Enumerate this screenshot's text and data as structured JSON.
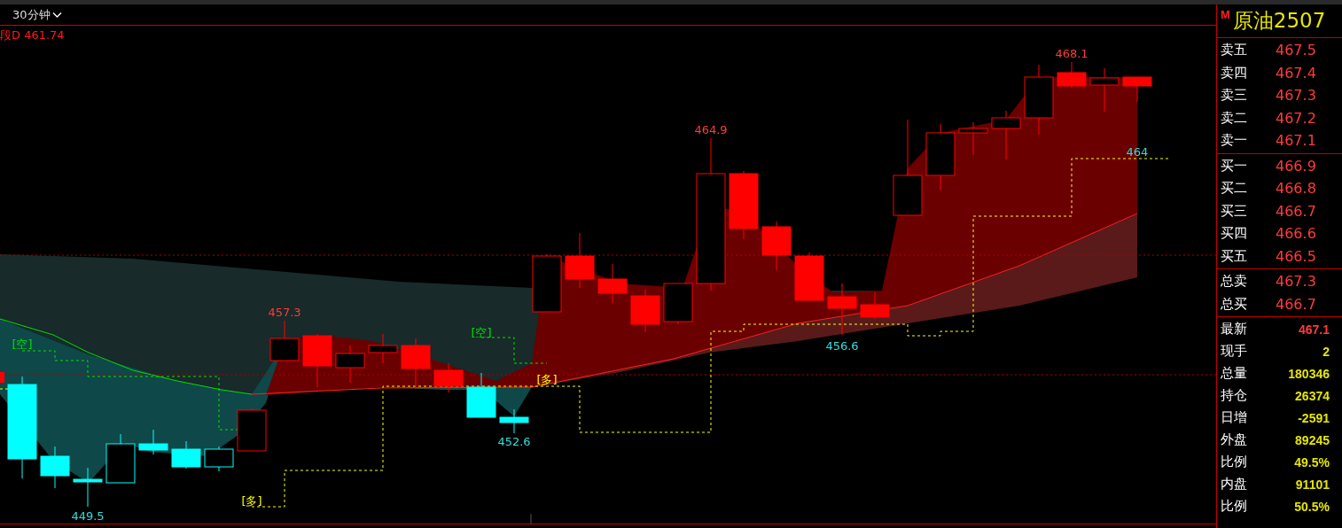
{
  "toolbar": {
    "period": "30分钟"
  },
  "indicator": {
    "label": "段D 461.74"
  },
  "chart": {
    "labels": [
      {
        "text": "449.5",
        "kind": "low"
      },
      {
        "text": "[空]",
        "kind": "short"
      },
      {
        "text": "[多]",
        "kind": "long"
      },
      {
        "text": "457.3",
        "kind": "high"
      },
      {
        "text": "[空]",
        "kind": "short"
      },
      {
        "text": "452.6",
        "kind": "low"
      },
      {
        "text": "[多]",
        "kind": "long"
      },
      {
        "text": "464.9",
        "kind": "high"
      },
      {
        "text": "456.6",
        "kind": "low"
      },
      {
        "text": "468.1",
        "kind": "high"
      },
      {
        "text": "464",
        "kind": "low"
      }
    ]
  },
  "quote": {
    "badge": "M",
    "name": "原油2507",
    "groups": [
      [
        {
          "label": "卖五",
          "value": "467.5",
          "kind": "price"
        },
        {
          "label": "卖四",
          "value": "467.4",
          "kind": "price"
        },
        {
          "label": "卖三",
          "value": "467.3",
          "kind": "price"
        },
        {
          "label": "卖二",
          "value": "467.2",
          "kind": "price"
        },
        {
          "label": "卖一",
          "value": "467.1",
          "kind": "price"
        }
      ],
      [
        {
          "label": "买一",
          "value": "466.9",
          "kind": "price"
        },
        {
          "label": "买二",
          "value": "466.8",
          "kind": "price"
        },
        {
          "label": "买三",
          "value": "466.7",
          "kind": "price"
        },
        {
          "label": "买四",
          "value": "466.6",
          "kind": "price"
        },
        {
          "label": "买五",
          "value": "466.5",
          "kind": "price"
        }
      ],
      [
        {
          "label": "总卖",
          "value": "467.3",
          "kind": "price"
        },
        {
          "label": "总买",
          "value": "466.7",
          "kind": "price"
        }
      ],
      [
        {
          "label": "最新",
          "value": "467.1",
          "kind": "last"
        },
        {
          "label": "现手",
          "value": "2",
          "kind": "stat"
        },
        {
          "label": "总量",
          "value": "180346",
          "kind": "stat"
        },
        {
          "label": "持仓",
          "value": "26374",
          "kind": "stat"
        },
        {
          "label": "日增",
          "value": "-2591",
          "kind": "stat"
        },
        {
          "label": "外盘",
          "value": "89245",
          "kind": "stat"
        },
        {
          "label": "比例",
          "value": "49.5%",
          "kind": "stat"
        },
        {
          "label": "内盘",
          "value": "91101",
          "kind": "stat"
        },
        {
          "label": "比例",
          "value": "50.5%",
          "kind": "stat"
        }
      ]
    ]
  }
}
